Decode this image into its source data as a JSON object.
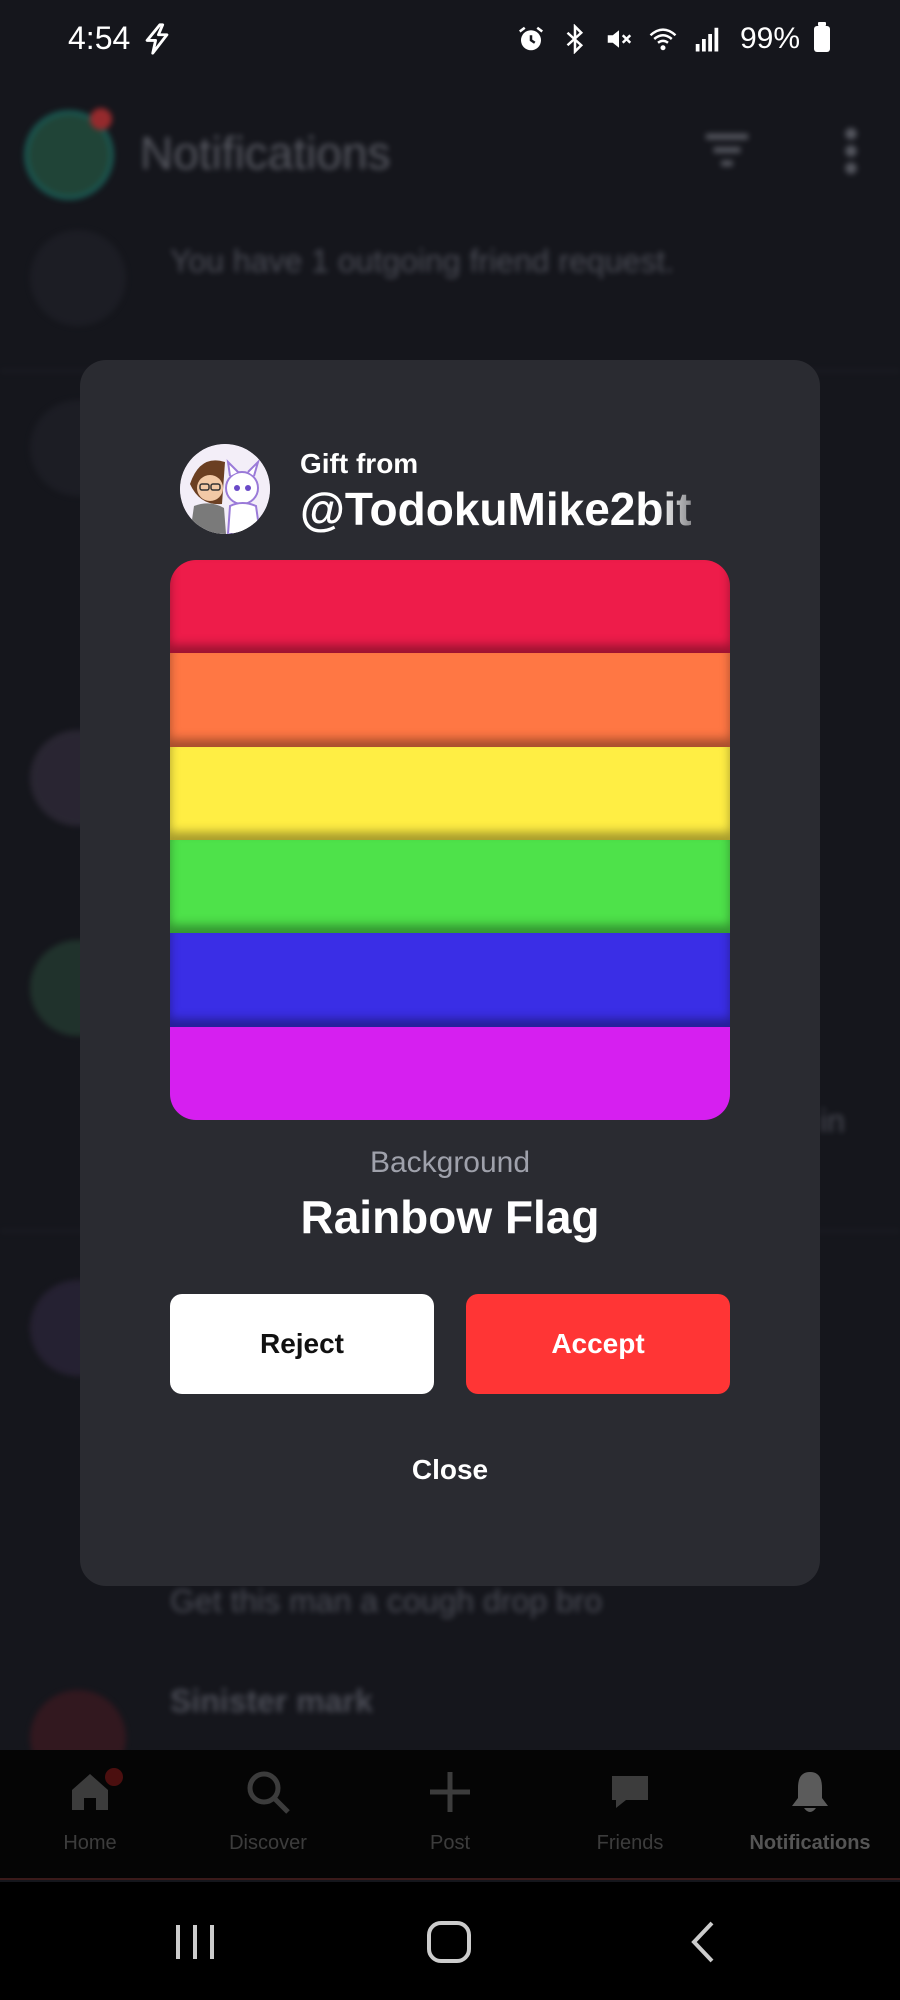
{
  "status_bar": {
    "time": "4:54",
    "battery_percent": "99%",
    "icons": [
      "bolt-icon",
      "alarm-icon",
      "bluetooth-icon",
      "mute-icon",
      "wifi-icon",
      "signal-icon",
      "battery-icon"
    ]
  },
  "background_app": {
    "title": "Notifications",
    "rows": [
      {
        "text": "You have 1 outgoing friend request."
      },
      {
        "text": "Get this man a cough drop bro"
      },
      {
        "text": "Sinister mark"
      }
    ],
    "partial_text": "in"
  },
  "bottom_nav": {
    "items": [
      {
        "label": "Home",
        "icon": "home-icon"
      },
      {
        "label": "Discover",
        "icon": "search-icon"
      },
      {
        "label": "Post",
        "icon": "plus-icon"
      },
      {
        "label": "Friends",
        "icon": "chat-icon"
      },
      {
        "label": "Notifications",
        "icon": "bell-icon"
      }
    ]
  },
  "modal": {
    "gift_label": "Gift from",
    "sender": "@TodokuMike2bit",
    "item_type": "Background",
    "item_name": "Rainbow Flag",
    "reject_label": "Reject",
    "accept_label": "Accept",
    "close_label": "Close",
    "flag_colors": [
      "#ee1c4a",
      "#ff7744",
      "#ffee44",
      "#4ee24a",
      "#3a2ee6",
      "#d61ff0"
    ]
  },
  "colors": {
    "accent": "#ff3535",
    "modal_bg": "#2a2b31",
    "page_bg": "#15161c"
  }
}
